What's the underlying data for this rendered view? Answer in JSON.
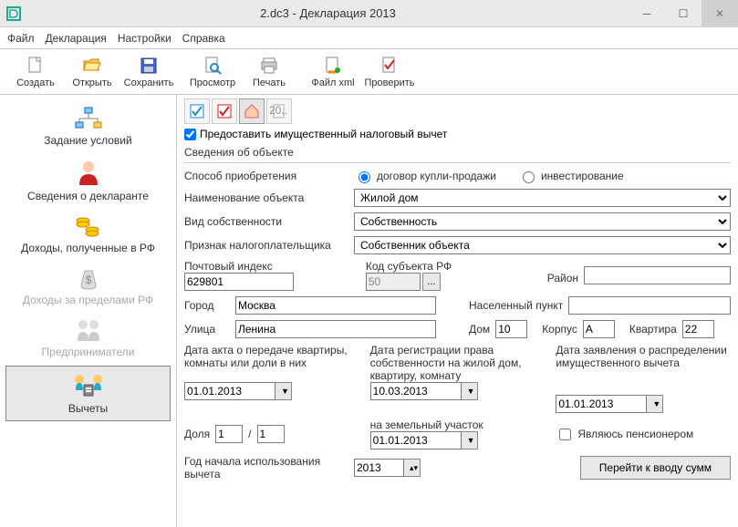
{
  "window": {
    "title": "2.dc3 - Декларация 2013"
  },
  "menu": {
    "file": "Файл",
    "declaration": "Декларация",
    "settings": "Настройки",
    "help": "Справка"
  },
  "toolbar": {
    "create": "Создать",
    "open": "Открыть",
    "save": "Сохранить",
    "preview": "Просмотр",
    "print": "Печать",
    "xml": "Файл xml",
    "check": "Проверить"
  },
  "sidebar": {
    "conditions": "Задание условий",
    "declarant": "Сведения о декларанте",
    "income_rf": "Доходы, полученные в РФ",
    "income_abroad": "Доходы за пределами РФ",
    "entrepreneurs": "Предприниматели",
    "deductions": "Вычеты"
  },
  "form": {
    "chk_label": "Предоставить имущественный налоговый вычет",
    "group_title": "Сведения об объекте",
    "acq_method_label": "Способ приобретения",
    "acq_opt1": "договор купли-продажи",
    "acq_opt2": "инвестирование",
    "obj_name_label": "Наименование объекта",
    "obj_name_val": "Жилой дом",
    "ownership_label": "Вид собственности",
    "ownership_val": "Собственность",
    "taxpayer_label": "Признак налогоплательщика",
    "taxpayer_val": "Собственник объекта",
    "postal_label": "Почтовый индекс",
    "postal_val": "629801",
    "region_code_label": "Код субъекта РФ",
    "region_code_val": "50",
    "district_label": "Район",
    "district_val": "",
    "city_label": "Город",
    "city_val": "Москва",
    "locality_label": "Населенный пункт",
    "locality_val": "",
    "street_label": "Улица",
    "street_val": "Ленина",
    "house_label": "Дом",
    "house_val": "10",
    "building_label": "Корпус",
    "building_val": "А",
    "flat_label": "Квартира",
    "flat_val": "22",
    "col1_label": "Дата акта о передаче квартиры, комнаты или доли в них",
    "col1_date": "01.01.2013",
    "col2_label": "Дата регистрации права собственности на жилой дом, квартиру, комнату",
    "col2_date": "10.03.2013",
    "col2b_label": "на земельный участок",
    "col2b_date": "01.01.2013",
    "col3_label": "Дата заявления о распределении имущественного вычета",
    "col3_date": "01.01.2013",
    "share_label": "Доля",
    "share_n": "1",
    "share_d": "1",
    "pensioner_label": "Являюсь пенсионером",
    "year_label": "Год начала использования вычета",
    "year_val": "2013",
    "goto_btn": "Перейти к вводу сумм"
  }
}
